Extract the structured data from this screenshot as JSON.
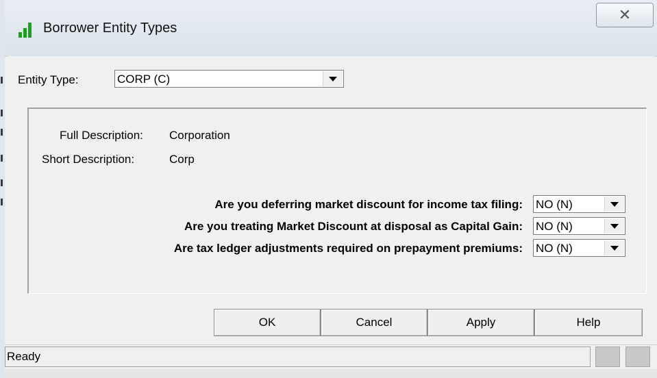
{
  "window": {
    "title": "Borrower Entity Types",
    "close_glyph": "✕"
  },
  "entity_type": {
    "label": "Entity Type:",
    "value": "CORP (C)"
  },
  "details": {
    "full_description_label": "Full Description:",
    "full_description_value": "Corporation",
    "short_description_label": "Short Description:",
    "short_description_value": "Corp"
  },
  "questions": [
    {
      "label": "Are you deferring market discount for income tax filing:",
      "value": "NO (N)"
    },
    {
      "label": "Are you treating Market Discount at disposal as Capital Gain:",
      "value": "NO (N)"
    },
    {
      "label": "Are tax ledger adjustments required on prepayment premiums:",
      "value": "NO (N)"
    }
  ],
  "buttons": {
    "ok": "OK",
    "cancel": "Cancel",
    "apply": "Apply",
    "help": "Help"
  },
  "status": {
    "text": "Ready"
  },
  "icons": {
    "app": "bar-chart-icon",
    "close": "close-icon",
    "dropdown": "chevron-down-icon"
  },
  "colors": {
    "icon_green": "#1aa21a",
    "dialog_bg": "#f0f0f0"
  }
}
